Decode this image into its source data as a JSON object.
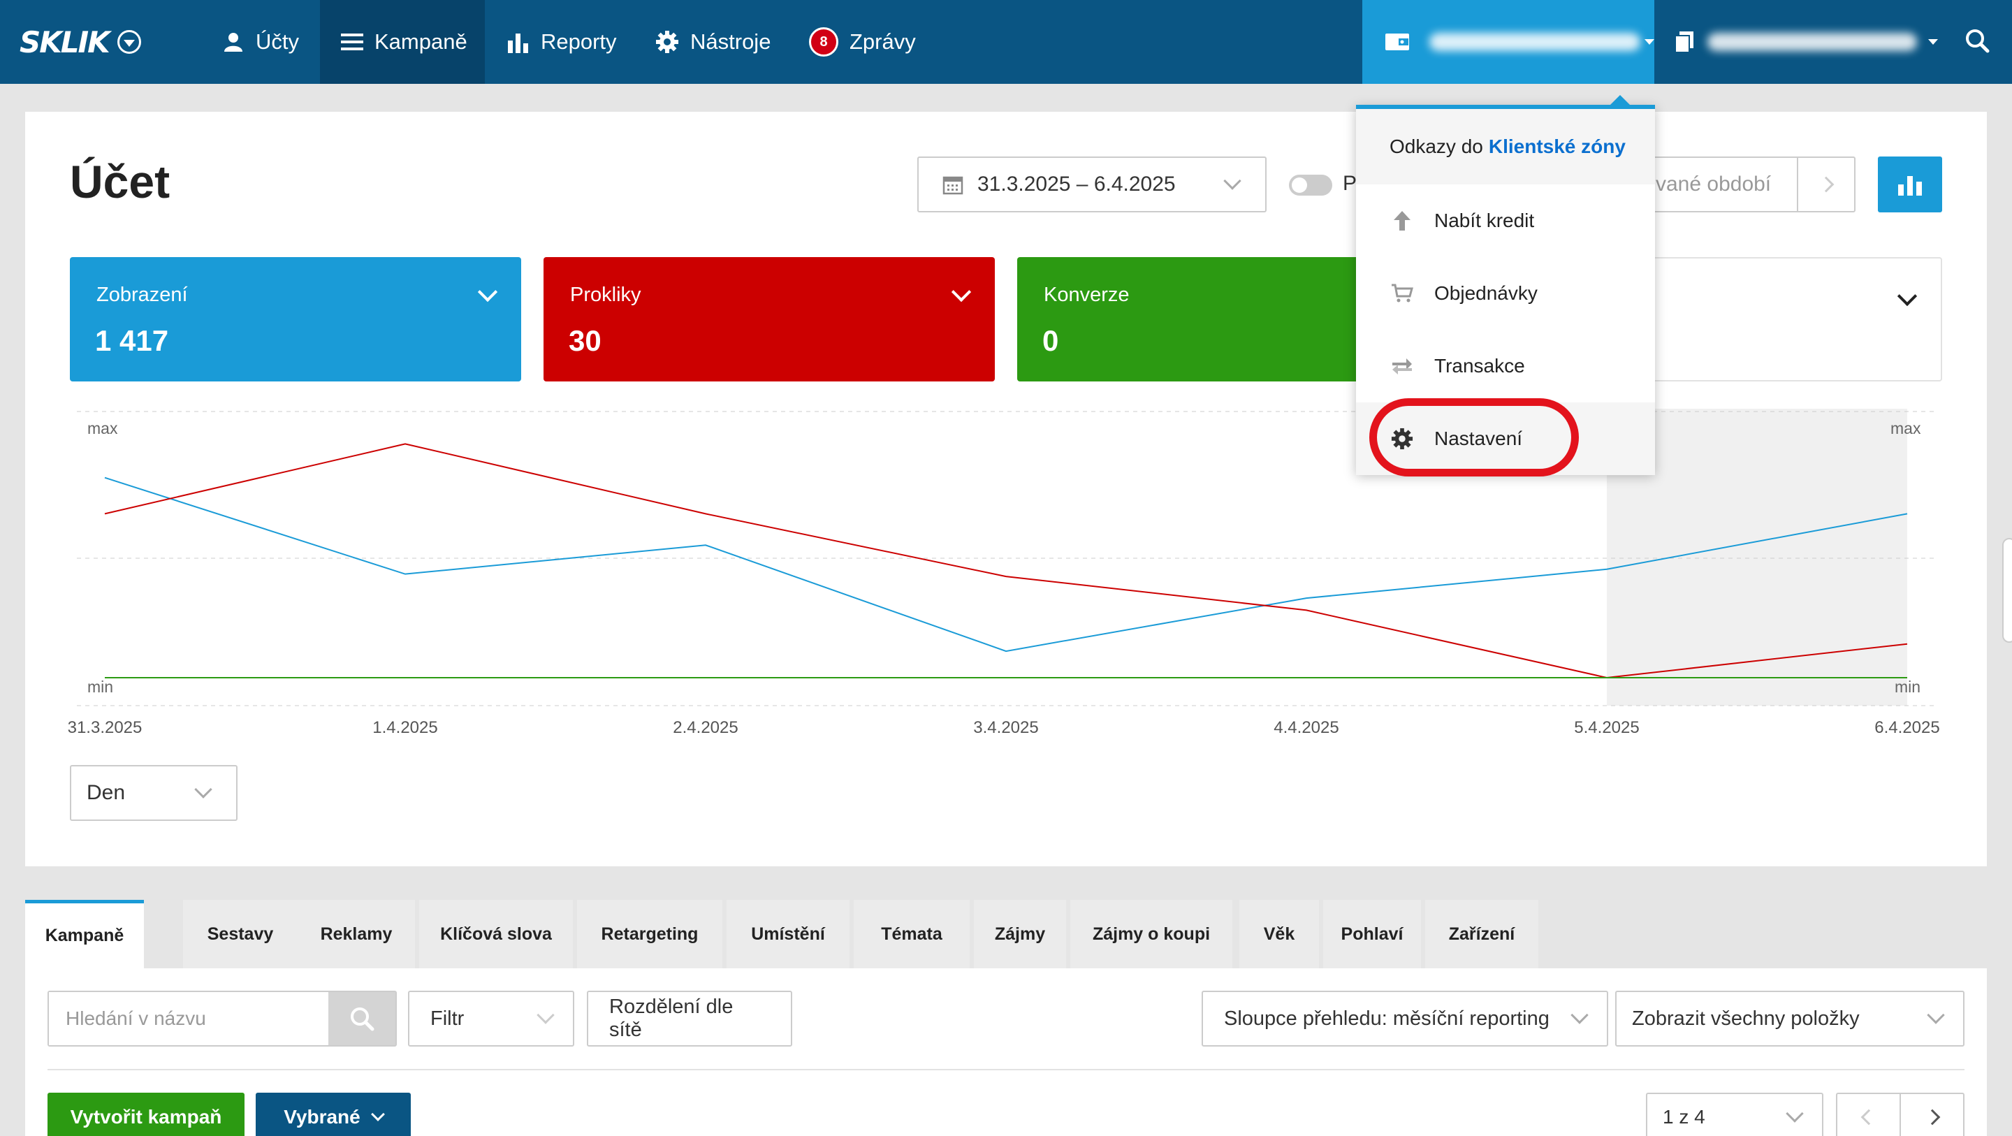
{
  "nav": {
    "logo": "SKLIK",
    "items": [
      {
        "label": "Účty",
        "icon": "user-icon"
      },
      {
        "label": "Kampaně",
        "icon": "menu-icon"
      },
      {
        "label": "Reporty",
        "icon": "bar-chart-icon"
      },
      {
        "label": "Nástroje",
        "icon": "gear-icon"
      },
      {
        "label": "Zprávy",
        "icon": "message-badge-icon",
        "badge": "8"
      }
    ]
  },
  "page": {
    "title": "Účet",
    "date_range": "31.3.2025 – 6.4.2025",
    "toggle_label": "P",
    "compare_placeholder": "vané období"
  },
  "metrics": [
    {
      "label": "Zobrazení",
      "value": "1 417",
      "color": "#1a9bd7"
    },
    {
      "label": "Prokliky",
      "value": "30",
      "color": "#cc0000"
    },
    {
      "label": "Konverze",
      "value": "0",
      "color": "#2c9a12"
    }
  ],
  "chart_data": {
    "type": "line",
    "x": [
      "31.3.2025",
      "1.4.2025",
      "2.4.2025",
      "3.4.2025",
      "4.4.2025",
      "5.4.2025",
      "6.4.2025"
    ],
    "series": [
      {
        "name": "Zobrazení",
        "color": "#1a9bd7",
        "values_normalized": [
          0.83,
          0.43,
          0.55,
          0.11,
          0.33,
          0.45,
          0.68
        ]
      },
      {
        "name": "Prokliky",
        "color": "#cc0000",
        "values_normalized": [
          0.68,
          0.97,
          0.68,
          0.42,
          0.28,
          0.0,
          0.14
        ]
      },
      {
        "name": "Konverze",
        "color": "#2c9a12",
        "values_normalized": [
          0,
          0,
          0,
          0,
          0,
          0,
          0
        ]
      }
    ],
    "y_labels": {
      "top_left": "max",
      "bottom_left": "min",
      "top_right": "max",
      "bottom_right": "min"
    },
    "grid": true
  },
  "granularity": "Den",
  "menu": {
    "header_prefix": "Odkazy do",
    "header_link": "Klientské zóny",
    "items": [
      {
        "label": "Nabít kredit",
        "icon": "arrow-up-icon"
      },
      {
        "label": "Objednávky",
        "icon": "cart-icon"
      },
      {
        "label": "Transakce",
        "icon": "transfer-icon"
      },
      {
        "label": "Nastavení",
        "icon": "gear-icon"
      }
    ]
  },
  "tabs": [
    "Kampaně",
    "Sestavy",
    "Reklamy",
    "Klíčová slova",
    "Retargeting",
    "Umístění",
    "Témata",
    "Zájmy",
    "Zájmy o koupi",
    "Věk",
    "Pohlaví",
    "Zařízení"
  ],
  "toolbar": {
    "search_placeholder": "Hledání v názvu",
    "filter": "Filtr",
    "split": "Rozdělení dle sítě",
    "columns": "Sloupce přehledu: měsíční reporting",
    "show": "Zobrazit všechny položky",
    "create": "Vytvořit kampaň",
    "selected": "Vybrané",
    "page": "1 z 4"
  }
}
